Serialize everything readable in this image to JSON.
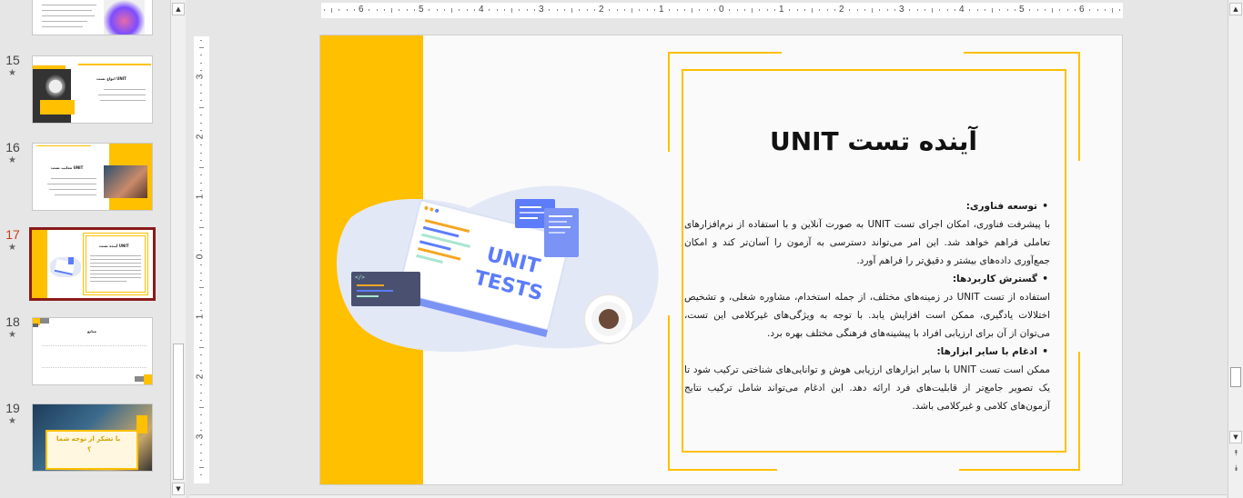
{
  "thumbnails": [
    {
      "number": "",
      "star": ""
    },
    {
      "number": "15",
      "star": "★",
      "title": "انواع تست UNIT"
    },
    {
      "number": "16",
      "star": "★",
      "title": "معایب تست UNIT"
    },
    {
      "number": "17",
      "star": "★",
      "title": "آینده تست UNIT"
    },
    {
      "number": "18",
      "star": "★",
      "title": "منابع"
    },
    {
      "number": "19",
      "star": "★",
      "title": "با تشکر از توجه شما",
      "subtitle": "؟"
    }
  ],
  "ruler": {
    "horizontal": [
      "6",
      "5",
      "4",
      "3",
      "2",
      "1",
      "0",
      "1",
      "2",
      "3",
      "4",
      "5",
      "6"
    ],
    "vertical": [
      "3",
      "2",
      "1",
      "0",
      "1",
      "2",
      "3"
    ]
  },
  "slide": {
    "title": "آینده تست UNIT",
    "illustration_text": [
      "UNIT",
      "TESTS"
    ],
    "code_tag": "</>",
    "bullets": [
      {
        "heading": "توسعه فناوری:",
        "text": "با پیشرفت فناوری، امکان اجرای تست UNIT  به صورت آنلاین و با استفاده از نرم‌افزارهای تعاملی فراهم خواهد شد. این امر می‌تواند دسترسی به آزمون را آسان‌تر کند و امکان جمع‌آوری داده‌های بیشتر و دقیق‌تر را فراهم آورد."
      },
      {
        "heading": "گسترش کاربردها:",
        "text": "استفاده از تست UNIT  در زمینه‌های مختلف، از جمله استخدام، مشاوره شغلی، و تشخیص اختلالات یادگیری، ممکن است افزایش یابد. با توجه به ویژگی‌های غیرکلامی این تست، می‌توان از آن برای ارزیابی افراد با پیشینه‌های فرهنگی مختلف بهره برد."
      },
      {
        "heading": "ادغام با سایر ابزارها:",
        "text": "ممکن است تست UNIT  با سایر ابزارهای ارزیابی هوش و توانایی‌های شناختی ترکیب شود تا یک تصویر جامع‌تر از قابلیت‌های فرد ارائه دهد. این ادغام می‌تواند شامل ترکیب نتایج آزمون‌های کلامی و غیرکلامی باشد."
      }
    ]
  },
  "colors": {
    "accent": "#ffc000",
    "active_thumb_border": "#8b1a1a",
    "active_thumb_number": "#c43e1c",
    "illustration_blue": "#5c7cfa"
  },
  "icons": {
    "scroll_up": "▲",
    "scroll_down": "▼",
    "prev_slide": "⯭",
    "next_slide": "⯯"
  }
}
